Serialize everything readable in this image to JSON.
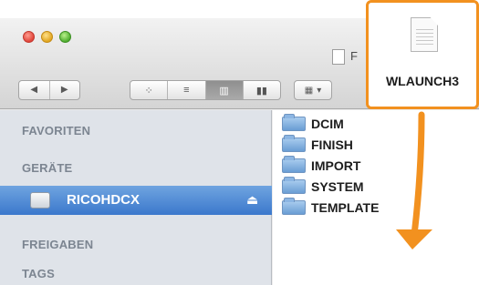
{
  "window": {
    "title": "F",
    "nav": {
      "back_icon": "◀",
      "forward_icon": "▶"
    },
    "view_buttons": [
      {
        "name": "icon-view",
        "glyph": "⁘",
        "active": false
      },
      {
        "name": "list-view",
        "glyph": "≡",
        "active": false
      },
      {
        "name": "column-view",
        "glyph": "▥",
        "active": true
      },
      {
        "name": "coverflow-view",
        "glyph": "▮▮",
        "active": false
      }
    ],
    "arrange": {
      "glyph": "▦",
      "chevron": "▾"
    }
  },
  "sidebar": {
    "favorites_label": "FAVORITEN",
    "devices_label": "GERÄTE",
    "selected_device": "RICOHDCX",
    "eject_glyph": "⏏",
    "shared_label": "FREIGABEN",
    "tags_label": "TAGS"
  },
  "content": {
    "folders": [
      "DCIM",
      "FINISH",
      "IMPORT",
      "SYSTEM",
      "TEMPLATE"
    ]
  },
  "dragged_file": {
    "name": "WLAUNCH3"
  },
  "colors": {
    "highlight": "#f2911f",
    "selection": "#3b78cc",
    "sidebar_bg": "#dfe3e9"
  }
}
